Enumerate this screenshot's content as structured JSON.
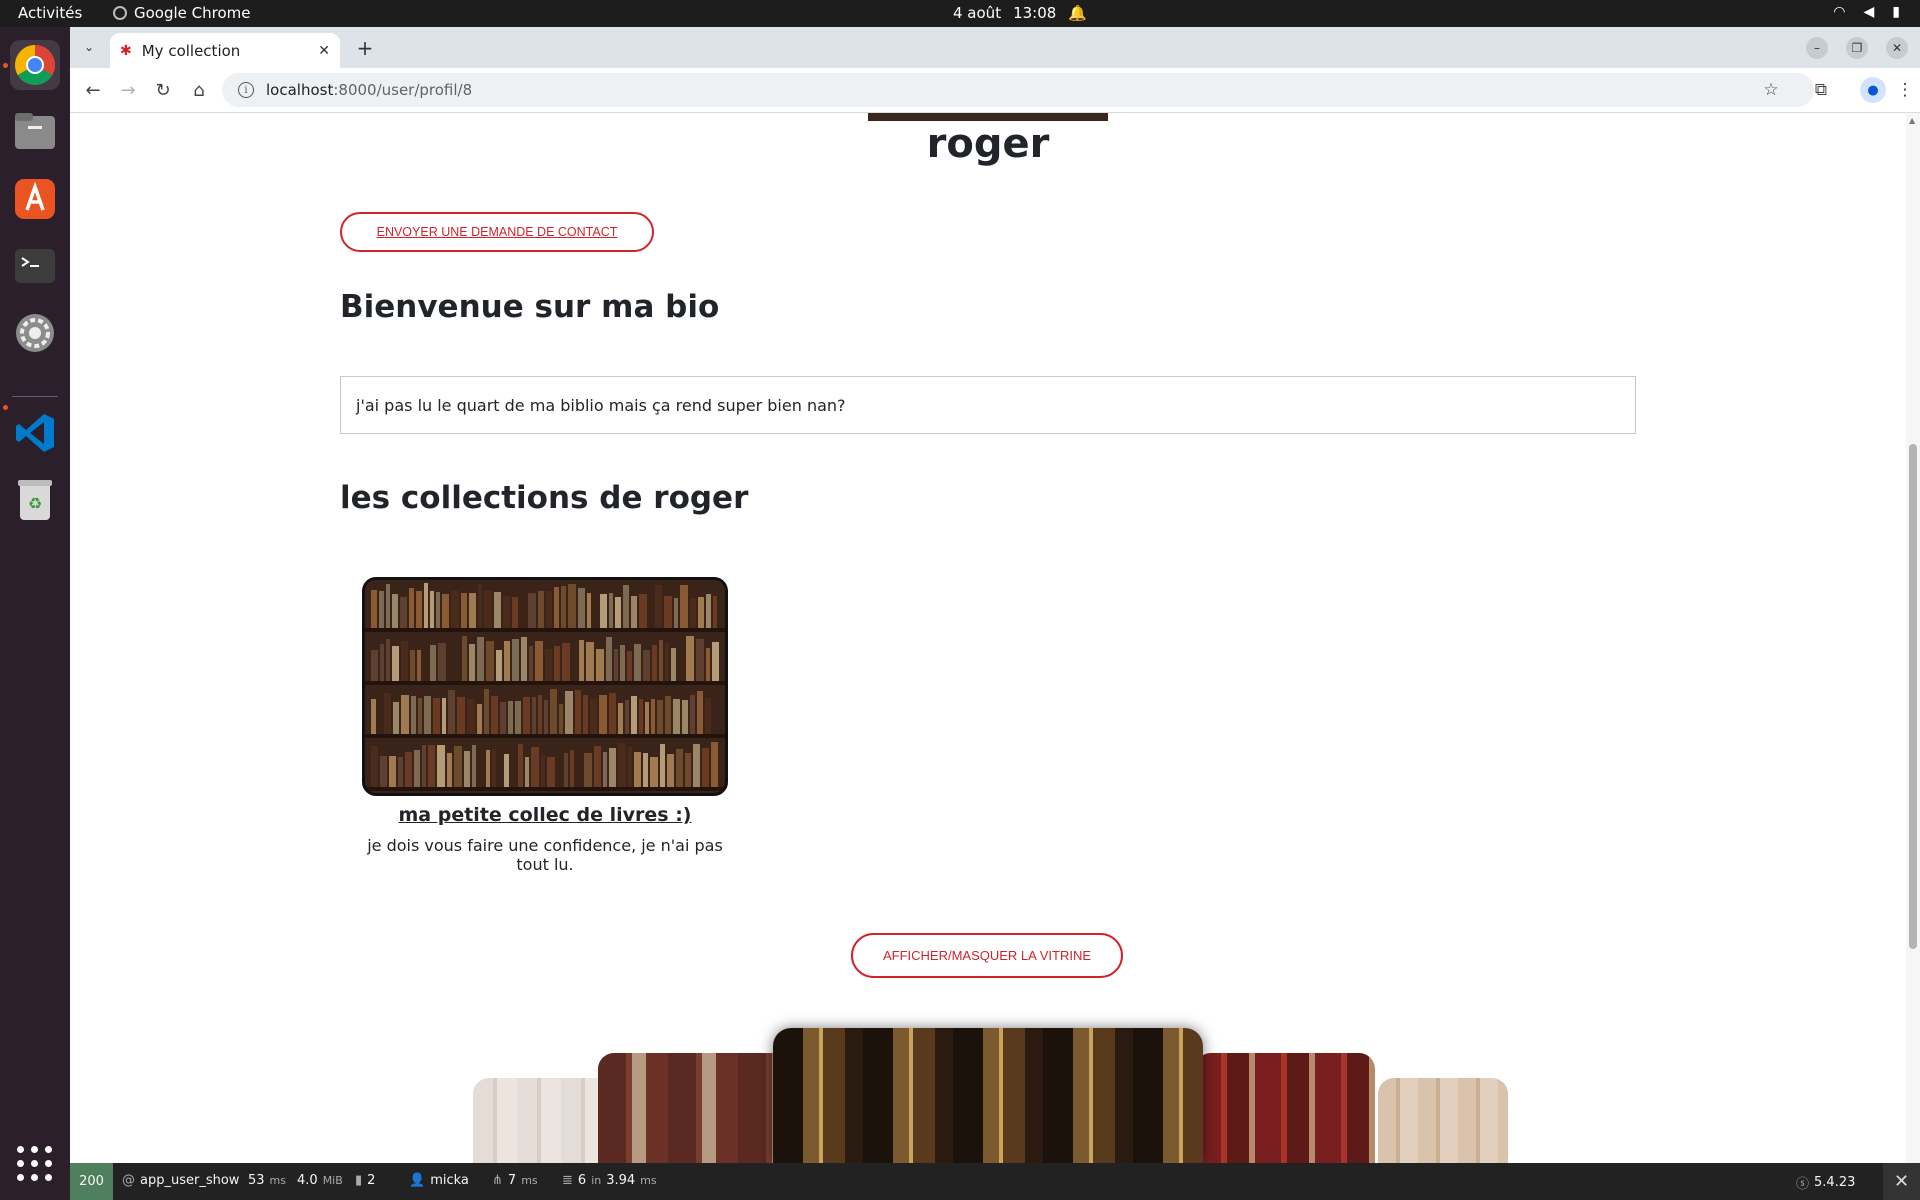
{
  "system": {
    "activities": "Activités",
    "app_name": "Google Chrome",
    "date": "4 août",
    "time": "13:08"
  },
  "browser": {
    "tab_title": "My collection",
    "url_host": "localhost",
    "url_path": ":8000/user/profil/8"
  },
  "profile": {
    "username": "roger",
    "contact_button": "ENVOYER UNE DEMANDE DE CONTACT",
    "bio_heading": "Bienvenue sur ma bio",
    "bio_text": "j'ai pas lu le quart de ma biblio mais ça rend super bien nan?",
    "collections_heading": "les collections de roger"
  },
  "collections": [
    {
      "title": "ma petite collec de livres :)",
      "description": "je dois vous faire une confidence, je n'ai pas tout lu."
    }
  ],
  "vitrine_button": "AFFICHER/MASQUER LA VITRINE",
  "debug_toolbar": {
    "status_code": "200",
    "route": "app_user_show",
    "time_value": "53",
    "time_unit": "ms",
    "memory_value": "4.0",
    "memory_unit": "MiB",
    "logs_count": "2",
    "user": "micka",
    "twig_time": "7",
    "twig_unit": "ms",
    "db_queries": "6",
    "db_in": "in",
    "db_time": "3.94",
    "db_unit": "ms",
    "symfony_version": "5.4.23"
  },
  "colors": {
    "accent": "#d2232a",
    "dock_bg": "#2b1f2c",
    "status_ok": "#4f805d"
  }
}
